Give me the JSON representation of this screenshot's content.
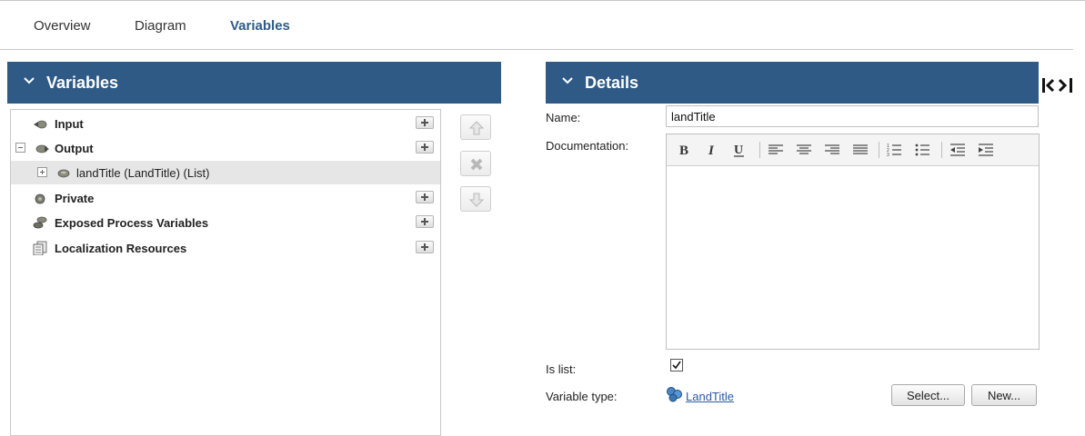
{
  "tabs": [
    {
      "label": "Overview"
    },
    {
      "label": "Diagram"
    },
    {
      "label": "Variables",
      "active": true
    }
  ],
  "variables_panel": {
    "title": "Variables",
    "tree": [
      {
        "label": "Input",
        "bold": true
      },
      {
        "label": "Output",
        "bold": true,
        "expanded": true
      },
      {
        "label": "landTitle (LandTitle) (List)",
        "bold": false,
        "selected": true
      },
      {
        "label": "Private",
        "bold": true
      },
      {
        "label": "Exposed Process Variables",
        "bold": true
      },
      {
        "label": "Localization Resources",
        "bold": true
      }
    ]
  },
  "details_panel": {
    "title": "Details",
    "name_label": "Name:",
    "name_value": "landTitle",
    "documentation_label": "Documentation:",
    "is_list_label": "Is list:",
    "is_list_checked": true,
    "variable_type_label": "Variable type:",
    "variable_type_value": "LandTitle",
    "select_button": "Select...",
    "new_button": "New..."
  },
  "colors": {
    "header_bg": "#2f5a86",
    "link": "#2a5aa8"
  }
}
